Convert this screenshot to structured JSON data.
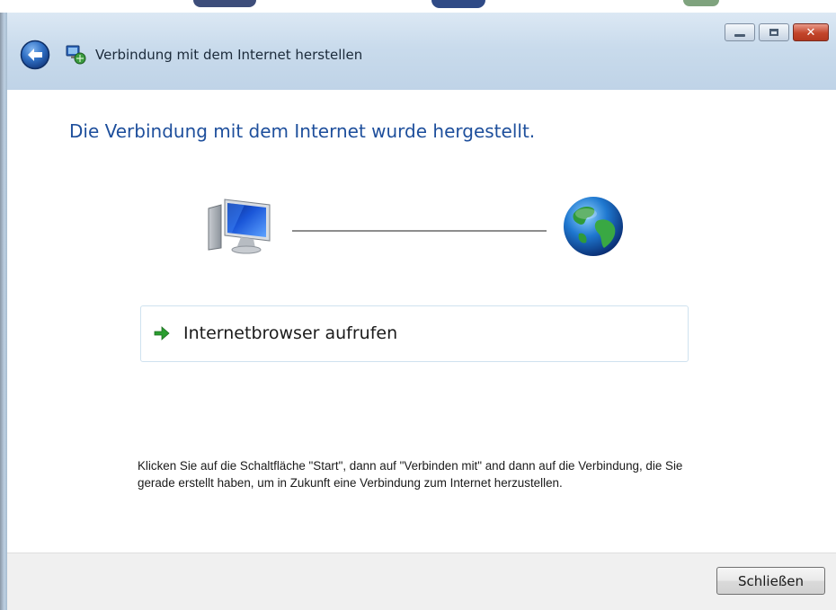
{
  "window": {
    "title": "Verbindung mit dem Internet herstellen",
    "controls": {
      "minimize": "minimize-icon",
      "maximize": "maximize-icon",
      "close": "close-icon"
    }
  },
  "nav": {
    "back_icon": "back-arrow-icon"
  },
  "main": {
    "heading": "Die Verbindung mit dem Internet wurde hergestellt.",
    "diagram": {
      "left_icon": "computer-icon",
      "right_icon": "globe-icon"
    },
    "browser_link": {
      "label": "Internetbrowser aufrufen",
      "icon": "green-arrow-icon"
    },
    "instruction": "Klicken Sie auf die Schaltfläche \"Start\", dann auf \"Verbinden mit\" and dann auf die Verbindung, die Sie gerade erstellt haben, um in Zukunft eine Verbindung zum Internet herzustellen."
  },
  "footer": {
    "close_label": "Schließen"
  },
  "colors": {
    "heading": "#1e4f9c",
    "titlebar": "#c9dbec",
    "footer": "#f0f0f0",
    "link_border": "#cfe2ef"
  }
}
